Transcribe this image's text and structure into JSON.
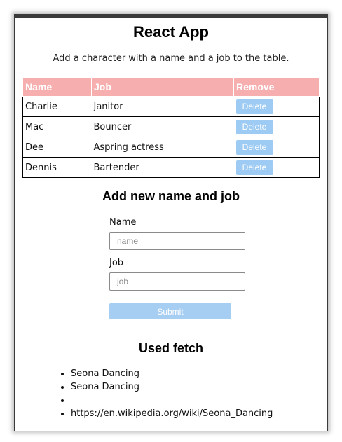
{
  "app": {
    "title": "React App",
    "subtitle": "Add a character with a name and a job to the table."
  },
  "table": {
    "headers": {
      "name": "Name",
      "job": "Job",
      "remove": "Remove"
    },
    "rows": [
      {
        "name": "Charlie",
        "job": "Janitor",
        "action": "Delete"
      },
      {
        "name": "Mac",
        "job": "Bouncer",
        "action": "Delete"
      },
      {
        "name": "Dee",
        "job": "Aspring actress",
        "action": "Delete"
      },
      {
        "name": "Dennis",
        "job": "Bartender",
        "action": "Delete"
      }
    ]
  },
  "form": {
    "title": "Add new name and job",
    "name_label": "Name",
    "name_placeholder": "name",
    "name_value": "",
    "job_label": "Job",
    "job_placeholder": "job",
    "job_value": "",
    "submit_label": "Submit"
  },
  "fetch": {
    "title": "Used fetch",
    "items": [
      "Seona Dancing",
      "Seona Dancing",
      "",
      "https://en.wikipedia.org/wiki/Seona_Dancing"
    ]
  },
  "colors": {
    "header_bg": "#f6aeae",
    "button_bg": "#9ecbf3",
    "submit_bg": "#a6cdf2"
  }
}
